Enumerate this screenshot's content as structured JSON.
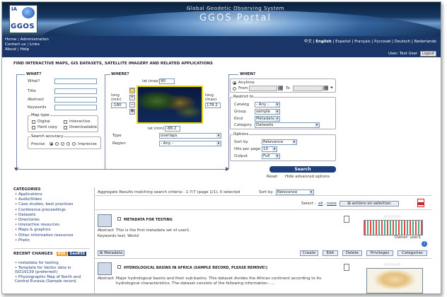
{
  "header": {
    "logo_text": "GGOS",
    "logo_ia": "IA",
    "subtitle": "Global Geodetic Observing System",
    "title": "GGOS Portal"
  },
  "nav": {
    "home": "Home",
    "administration": "Administration",
    "contact": "Contact us",
    "links": "Links",
    "about": "About",
    "help": "Help",
    "languages": [
      "中文",
      "English",
      "Español",
      "Français",
      "Русский",
      "Deutsch",
      "Nederlands"
    ],
    "active_language": "English",
    "user_label": "User: Test User",
    "logout": "Logout"
  },
  "search": {
    "find_title": "FIND INTERACTIVE MAPS, GIS DATASETS, SATELLITE IMAGERY AND RELATED APPLICATIONS",
    "what": {
      "title": "WHAT?",
      "fields": [
        "What?",
        "Title",
        "Abstract",
        "Keywords"
      ],
      "map_type_legend": "Map type",
      "map_types": [
        "Digital",
        "Interactive",
        "Hard copy",
        "Downloadable"
      ],
      "accuracy_legend": "Search accuracy",
      "precise": "Precise",
      "imprecise": "Imprecise"
    },
    "where": {
      "title": "WHERE?",
      "lat_max_label": "lat (max)",
      "lat_max": "90",
      "long_min_label": "long (min)",
      "long_min": "-180",
      "long_max_label": "long (max)",
      "long_max": "178.2",
      "lat_min_label": "lat (min)",
      "lat_min": "-88.2",
      "type_label": "Type",
      "type_value": "overlaps",
      "region_label": "Region",
      "region_value": "- Any -"
    },
    "when": {
      "title": "WHEN?",
      "anytime": "Anytime",
      "from": "From",
      "to": "To"
    },
    "restrict": {
      "legend": "Restrict to",
      "catalog_label": "Catalog",
      "catalog_value": "- Any -",
      "group_label": "Group",
      "group_value": "sample",
      "kind_label": "Kind",
      "kind_value": "Metadata",
      "category_label": "Category",
      "category_value": "Datasets"
    },
    "options": {
      "legend": "Options",
      "sortby_label": "Sort by",
      "sortby_value": "Relevance",
      "hits_label": "Hits per page",
      "hits_value": "10",
      "output_label": "Output",
      "output_value": "Full"
    },
    "search_button": "Search",
    "reset": "Reset",
    "hide_advanced": "Hide advanced options"
  },
  "sidebar": {
    "categories_title": "CATEGORIES",
    "categories": [
      "Applications",
      "Audio/Video",
      "Case studies, best practices",
      "Conference proceedings",
      "Datasets",
      "Directories",
      "Interactive resources",
      "Maps & graphics",
      "Other information resources",
      "Photo"
    ],
    "recent_title": "RECENT CHANGES",
    "rss": "RSS",
    "georss": "GeoRSS",
    "recent": [
      "metadata for testing",
      "Template for Vector data in ISO19139 (preferred!)",
      "Physiographic Map of North and Central Eurasia (Sample record,"
    ]
  },
  "results": {
    "summary": "Aggregate Results matching search criteria :  1-7/7   (page 1/1),  0 selected",
    "sortby_label": "Sort by",
    "sortby_value": "Relevance",
    "select_label": "Select :",
    "select_all": "all",
    "select_none": "none",
    "actions_button": "actions on selection",
    "records": [
      {
        "title": "METADATA FOR TESTING",
        "abstract_label": "Abstract",
        "abstract": "This is the first metadata set of user1.",
        "keywords_label": "Keywords",
        "keywords": "test, World",
        "owner": "Owner: user1",
        "stars": "☆☆☆☆☆",
        "metadata_btn": "Metadata",
        "actions": [
          "Create",
          "Edit",
          "Delete",
          "Privileges",
          "Categories"
        ]
      },
      {
        "title": "HYDROLOGICAL BASINS IN AFRICA (SAMPLE RECORD, PLEASE REMOVE!)",
        "abstract_label": "Abstract",
        "abstract": "Major hydrological basins and their sub-basins. This dataset divides the African continent according to its hydrological characteristics. The dataset consists of the following information:- ...",
        "stars": "☆☆☆☆☆"
      }
    ]
  },
  "colors": {
    "navbar": "#1a3567",
    "search_button": "#1d3e7a",
    "link": "#1c3a7a",
    "map_border": "#e6d400"
  }
}
